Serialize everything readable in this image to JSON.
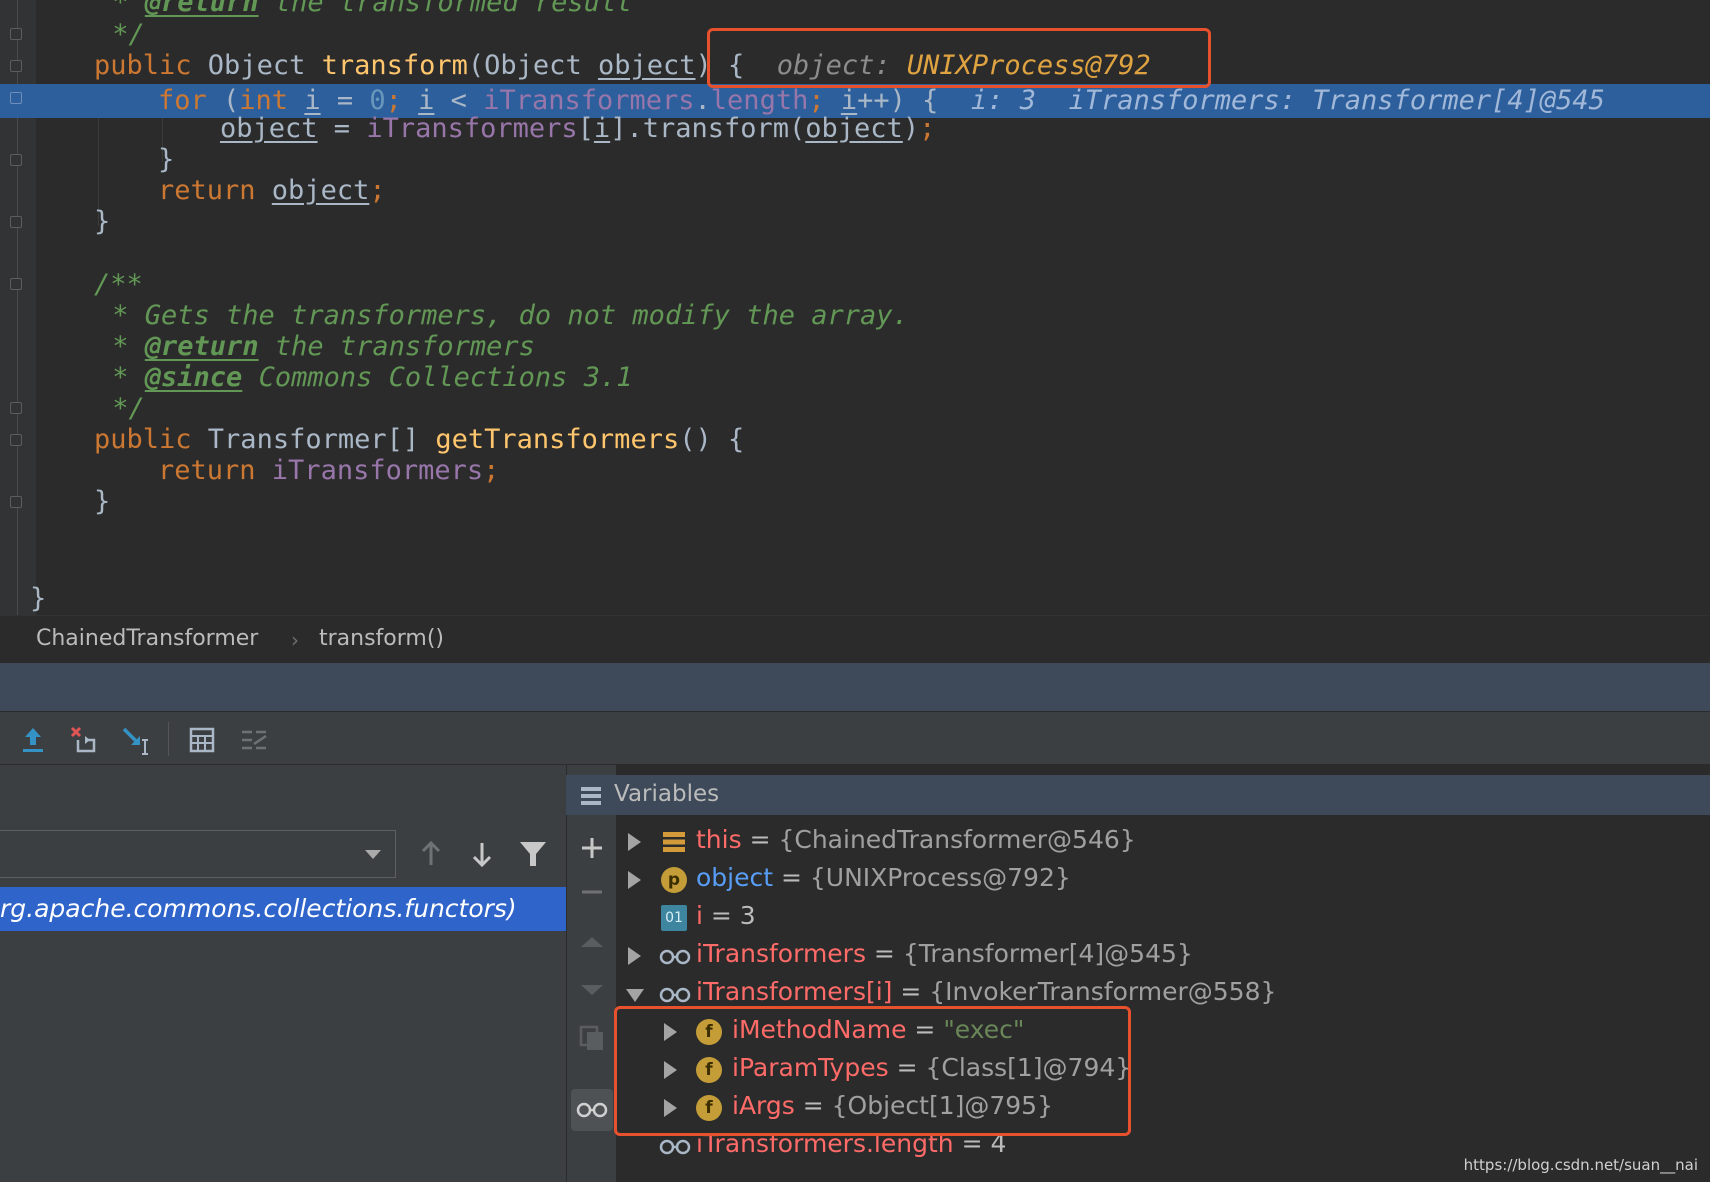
{
  "editor": {
    "lines": [
      {
        "text_doc_prefix": " * ",
        "tag": "@return",
        "doc_rest": " the transformed result"
      },
      {
        "doc": " */"
      },
      {
        "k1": "public ",
        "t1": "Object ",
        "fn": "transform",
        "p1": "(Object ",
        "u1": "object",
        "p2": ") ",
        "brace": "{"
      },
      {
        "k1": "for ",
        "p1": "(",
        "k2": "int ",
        "u1": "i",
        "p2": " = ",
        "n1": "0",
        "k3": "; ",
        "u2": "i",
        "p3": " < ",
        "f1": "iTransformers",
        "p4": ".",
        "f2": "length",
        "k4": "; ",
        "u3": "i",
        "p5": "++) {"
      },
      {
        "u1": "object",
        "p1": " = ",
        "f1": "iTransformers",
        "p2": "[",
        "u2": "i",
        "p3": "].transform(",
        "u3": "object",
        "p4": ")",
        "k1": ";"
      },
      {
        "p1": "}"
      },
      {
        "k1": "return ",
        "u1": "object",
        "k2": ";"
      },
      {
        "p1": "}"
      },
      {
        "doc": "/**"
      },
      {
        "doc": " * Gets the transformers, do not modify the array."
      },
      {
        "text_doc_prefix": " * ",
        "tag": "@return",
        "doc_rest": " the transformers"
      },
      {
        "text_doc_prefix": " * ",
        "tag": "@since",
        "doc_rest": " Commons Collections 3.1"
      },
      {
        "doc": " */"
      },
      {
        "k1": "public ",
        "t1": "Transformer[] ",
        "fn": "getTransformers",
        "p1": "() {"
      },
      {
        "k1": "return ",
        "f1": "iTransformers",
        "k2": ";"
      },
      {
        "p1": "}"
      },
      {
        "p1": "}"
      }
    ],
    "inline_hints": {
      "transform_object_key": "object: ",
      "transform_object_val": "UNIXProcess@792",
      "loop_hint": "i: 3  iTransformers: Transformer[4]@545"
    }
  },
  "breadcrumb": {
    "class_name": "ChainedTransformer",
    "separator": "›",
    "method_name": "transform()"
  },
  "frames": {
    "selected_frame": "rg.apache.commons.collections.functors)"
  },
  "variables": {
    "title": "Variables",
    "rows": [
      {
        "name": "this",
        "eq": " = ",
        "value": "{ChainedTransformer@546}",
        "icon": "stack-icon"
      },
      {
        "name": "object",
        "eq": " = ",
        "value": "{UNIXProcess@792}",
        "icon": "parameter-icon",
        "badge": "p"
      },
      {
        "name": "i",
        "eq": " = ",
        "value": "3",
        "icon": "primitive-icon",
        "badge": "01"
      },
      {
        "name": "iTransformers",
        "eq": " = ",
        "value": "{Transformer[4]@545}",
        "icon": "watch-glasses-icon"
      },
      {
        "name": "iTransformers[i]",
        "eq": " = ",
        "value": "{InvokerTransformer@558}",
        "icon": "watch-glasses-icon"
      },
      {
        "name": "iMethodName",
        "eq": " = ",
        "value": "\"exec\"",
        "icon": "field-icon",
        "badge": "f"
      },
      {
        "name": "iParamTypes",
        "eq": " = ",
        "value": "{Class[1]@794}",
        "icon": "field-icon",
        "badge": "f"
      },
      {
        "name": "iArgs",
        "eq": " = ",
        "value": "{Object[1]@795}",
        "icon": "field-icon",
        "badge": "f"
      },
      {
        "name": "iTransformers.length",
        "eq": " = ",
        "value": "4",
        "icon": "watch-glasses-icon"
      }
    ]
  },
  "watermark": "https://blog.csdn.net/suan__nai",
  "colors": {
    "accent_highlight": "#2d5f9d",
    "selected_frame": "#2f65ca",
    "annotation_red": "#e8512e",
    "var_name": "#ff6b68"
  }
}
